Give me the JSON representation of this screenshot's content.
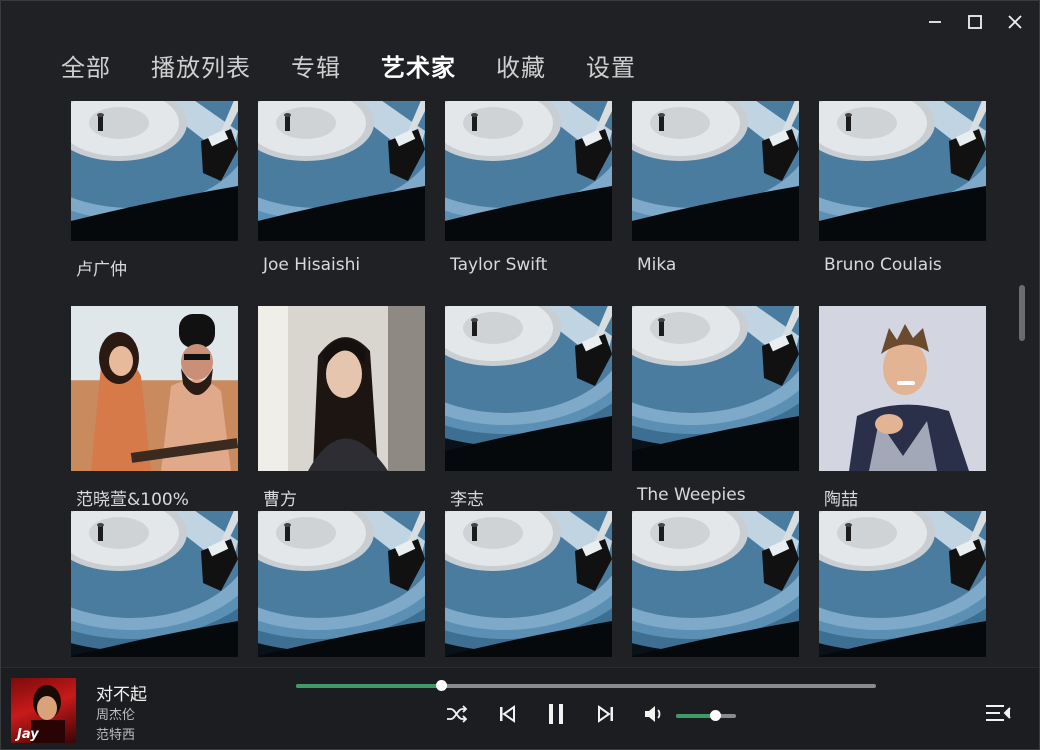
{
  "window": {
    "controls": [
      "minimize-icon",
      "maximize-icon",
      "close-icon"
    ]
  },
  "tabs": [
    {
      "label": "全部",
      "active": false
    },
    {
      "label": "播放列表",
      "active": false
    },
    {
      "label": "专辑",
      "active": false
    },
    {
      "label": "艺术家",
      "active": true
    },
    {
      "label": "收藏",
      "active": false
    },
    {
      "label": "设置",
      "active": false
    }
  ],
  "artists": [
    {
      "name": "卢广仲",
      "image": "vinyl"
    },
    {
      "name": "Joe Hisaishi",
      "image": "vinyl"
    },
    {
      "name": "Taylor Swift",
      "image": "vinyl"
    },
    {
      "name": "Mika",
      "image": "vinyl"
    },
    {
      "name": "Bruno Coulais",
      "image": "vinyl"
    },
    {
      "name": "范晓萱&100%",
      "image": "photo-duo"
    },
    {
      "name": "曹方",
      "image": "photo-woman"
    },
    {
      "name": "李志",
      "image": "vinyl"
    },
    {
      "name": "The Weepies",
      "image": "vinyl"
    },
    {
      "name": "陶喆",
      "image": "photo-man"
    },
    {
      "name": "",
      "image": "vinyl"
    },
    {
      "name": "",
      "image": "vinyl"
    },
    {
      "name": "",
      "image": "vinyl"
    },
    {
      "name": "",
      "image": "vinyl"
    },
    {
      "name": "",
      "image": "vinyl"
    }
  ],
  "player": {
    "title": "对不起",
    "artist": "周杰伦",
    "album": "范特西",
    "progress": 0.25,
    "volume": 0.65,
    "accent_color": "#3d9b66",
    "icons": [
      "shuffle-icon",
      "previous-icon",
      "pause-icon",
      "next-icon",
      "volume-icon",
      "playlist-queue-icon"
    ]
  }
}
